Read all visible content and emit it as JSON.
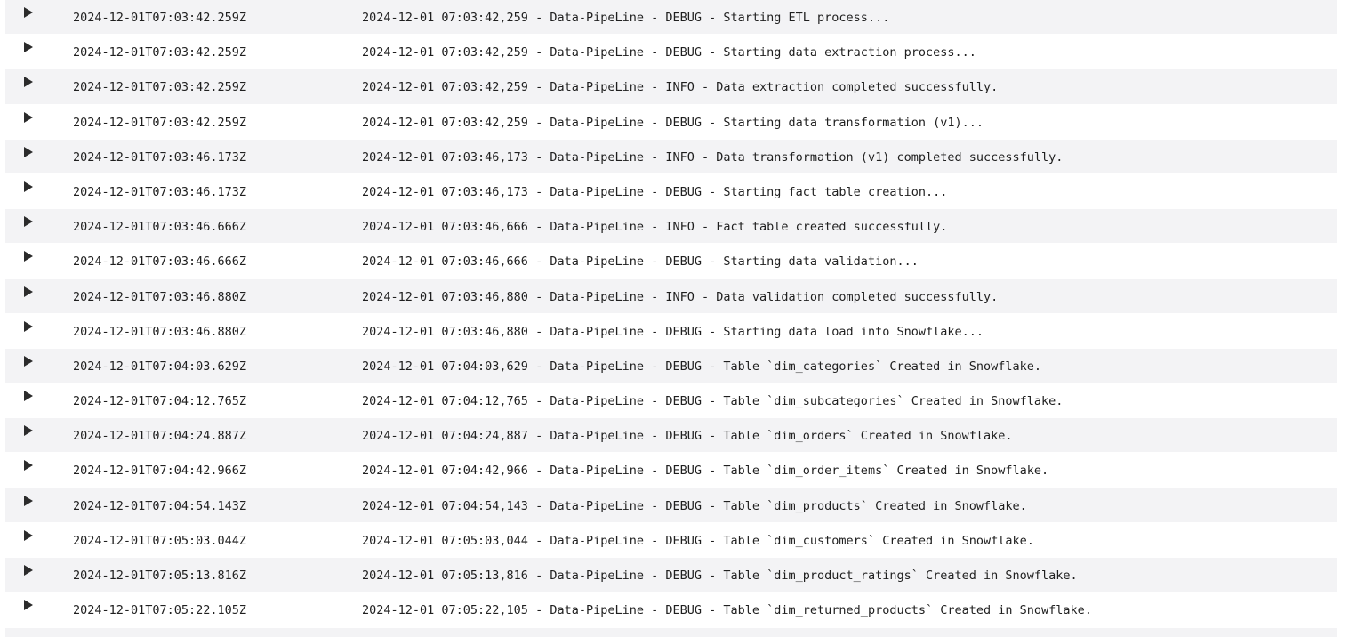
{
  "icons": {
    "expand": "caret-right-icon"
  },
  "colors": {
    "row_stripe": "#f3f3f5",
    "text": "#1f1f1f",
    "caret": "#2b2b2b"
  },
  "log": {
    "rows": [
      {
        "timestamp": "2024-12-01T07:03:42.259Z",
        "message": "2024-12-01 07:03:42,259 - Data-PipeLine - DEBUG - Starting ETL process..."
      },
      {
        "timestamp": "2024-12-01T07:03:42.259Z",
        "message": "2024-12-01 07:03:42,259 - Data-PipeLine - DEBUG - Starting data extraction process..."
      },
      {
        "timestamp": "2024-12-01T07:03:42.259Z",
        "message": "2024-12-01 07:03:42,259 - Data-PipeLine - INFO - Data extraction completed successfully."
      },
      {
        "timestamp": "2024-12-01T07:03:42.259Z",
        "message": "2024-12-01 07:03:42,259 - Data-PipeLine - DEBUG - Starting data transformation (v1)..."
      },
      {
        "timestamp": "2024-12-01T07:03:46.173Z",
        "message": "2024-12-01 07:03:46,173 - Data-PipeLine - INFO - Data transformation (v1) completed successfully."
      },
      {
        "timestamp": "2024-12-01T07:03:46.173Z",
        "message": "2024-12-01 07:03:46,173 - Data-PipeLine - DEBUG - Starting fact table creation..."
      },
      {
        "timestamp": "2024-12-01T07:03:46.666Z",
        "message": "2024-12-01 07:03:46,666 - Data-PipeLine - INFO - Fact table created successfully."
      },
      {
        "timestamp": "2024-12-01T07:03:46.666Z",
        "message": "2024-12-01 07:03:46,666 - Data-PipeLine - DEBUG - Starting data validation..."
      },
      {
        "timestamp": "2024-12-01T07:03:46.880Z",
        "message": "2024-12-01 07:03:46,880 - Data-PipeLine - INFO - Data validation completed successfully."
      },
      {
        "timestamp": "2024-12-01T07:03:46.880Z",
        "message": "2024-12-01 07:03:46,880 - Data-PipeLine - DEBUG - Starting data load into Snowflake..."
      },
      {
        "timestamp": "2024-12-01T07:04:03.629Z",
        "message": "2024-12-01 07:04:03,629 - Data-PipeLine - DEBUG - Table `dim_categories` Created in Snowflake."
      },
      {
        "timestamp": "2024-12-01T07:04:12.765Z",
        "message": "2024-12-01 07:04:12,765 - Data-PipeLine - DEBUG - Table `dim_subcategories` Created in Snowflake."
      },
      {
        "timestamp": "2024-12-01T07:04:24.887Z",
        "message": "2024-12-01 07:04:24,887 - Data-PipeLine - DEBUG - Table `dim_orders` Created in Snowflake."
      },
      {
        "timestamp": "2024-12-01T07:04:42.966Z",
        "message": "2024-12-01 07:04:42,966 - Data-PipeLine - DEBUG - Table `dim_order_items` Created in Snowflake."
      },
      {
        "timestamp": "2024-12-01T07:04:54.143Z",
        "message": "2024-12-01 07:04:54,143 - Data-PipeLine - DEBUG - Table `dim_products` Created in Snowflake."
      },
      {
        "timestamp": "2024-12-01T07:05:03.044Z",
        "message": "2024-12-01 07:05:03,044 - Data-PipeLine - DEBUG - Table `dim_customers` Created in Snowflake."
      },
      {
        "timestamp": "2024-12-01T07:05:13.816Z",
        "message": "2024-12-01 07:05:13,816 - Data-PipeLine - DEBUG - Table `dim_product_ratings` Created in Snowflake."
      },
      {
        "timestamp": "2024-12-01T07:05:22.105Z",
        "message": "2024-12-01 07:05:22,105 - Data-PipeLine - DEBUG - Table `dim_returned_products` Created in Snowflake."
      }
    ]
  }
}
